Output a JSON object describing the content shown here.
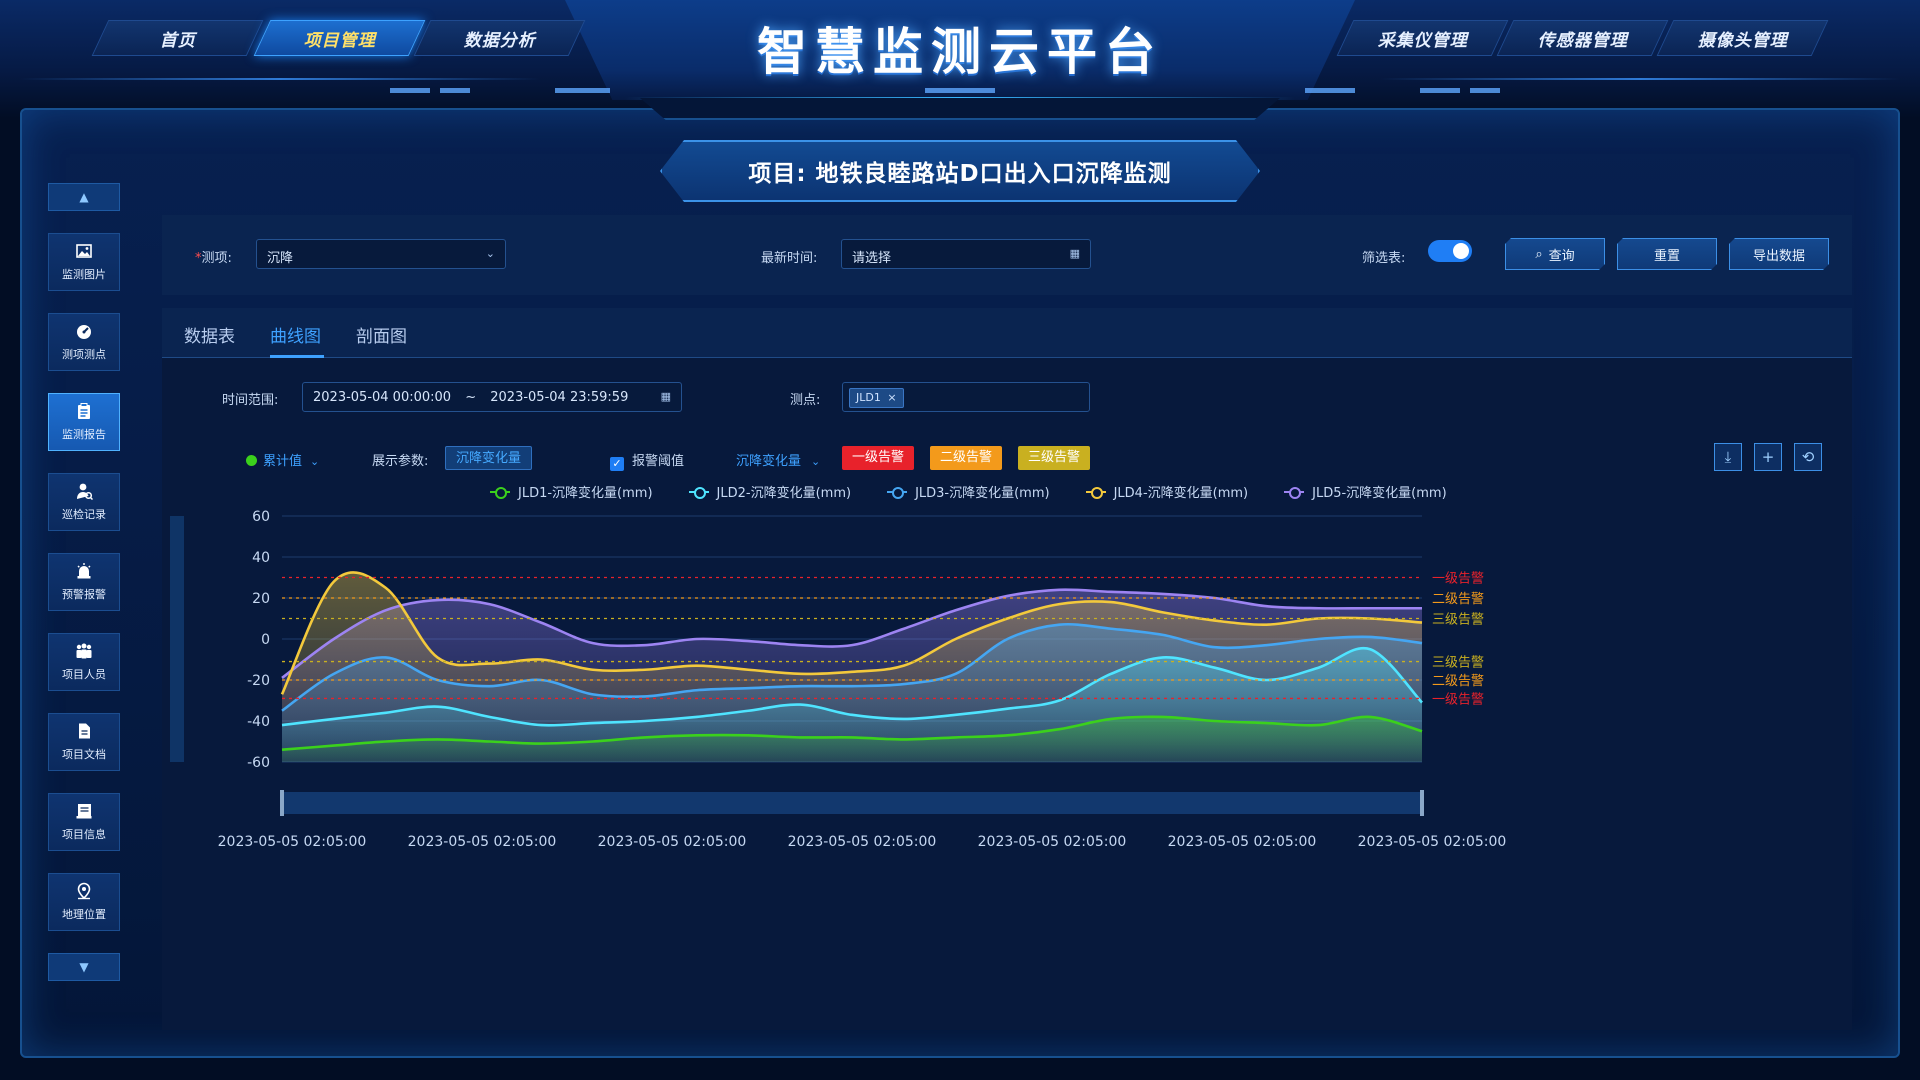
{
  "header": {
    "title": "智慧监测云平台",
    "nav_left": [
      "首页",
      "项目管理",
      "数据分析"
    ],
    "nav_right": [
      "采集仪管理",
      "传感器管理",
      "摄像头管理"
    ],
    "active_nav": "项目管理"
  },
  "project_title": "项目: 地铁良睦路站D口出入口沉降监测",
  "sidebar": {
    "items": [
      {
        "label": "监测图片",
        "icon": "image-icon"
      },
      {
        "label": "测项测点",
        "icon": "gauge-icon"
      },
      {
        "label": "监测报告",
        "icon": "clipboard-icon"
      },
      {
        "label": "巡检记录",
        "icon": "inspector-icon"
      },
      {
        "label": "预警报警",
        "icon": "alarm-icon"
      },
      {
        "label": "项目人员",
        "icon": "team-icon"
      },
      {
        "label": "项目文档",
        "icon": "document-icon"
      },
      {
        "label": "项目信息",
        "icon": "info-card-icon"
      },
      {
        "label": "地理位置",
        "icon": "location-icon"
      }
    ],
    "active": "监测报告"
  },
  "filters": {
    "item_label": "测项:",
    "item_value": "沉降",
    "time_label": "最新时间:",
    "time_placeholder": "请选择",
    "filter_table_label": "筛选表:",
    "query_button": "查询",
    "reset_button": "重置",
    "export_button": "导出数据"
  },
  "tabs": [
    "数据表",
    "曲线图",
    "剖面图"
  ],
  "active_tab": "曲线图",
  "range": {
    "label": "时间范围:",
    "start": "2023-05-04 00:00:00",
    "sep": "~",
    "end": "2023-05-04 23:59:59",
    "point_label": "测点:",
    "point_tag": "JLD1"
  },
  "controls": {
    "mode": "累计值",
    "param_label": "展示参数:",
    "param_value": "沉降变化量",
    "threshold_label": "报警阈值",
    "threshold_param": "沉降变化量",
    "alarm_pills": [
      "一级告警",
      "二级告警",
      "三级告警"
    ]
  },
  "colors": {
    "level1": "#e8222b",
    "level2": "#f39a1b",
    "level3": "#c9b020",
    "accent": "#3ea1ff"
  },
  "chart_data": {
    "type": "area",
    "y_ticks": [
      60,
      40,
      20,
      0,
      -20,
      -40,
      -60
    ],
    "ylim": [
      -60,
      60
    ],
    "x_labels": [
      "2023-05-05 02:05:00",
      "2023-05-05 02:05:00",
      "2023-05-05 02:05:00",
      "2023-05-05 02:05:00",
      "2023-05-05 02:05:00",
      "2023-05-05 02:05:00",
      "2023-05-05 02:05:00"
    ],
    "thresholds": [
      {
        "label": "一级告警",
        "value": 30,
        "color": "#e8222b"
      },
      {
        "label": "二级告警",
        "value": 20,
        "color": "#f39a1b"
      },
      {
        "label": "三级告警",
        "value": 10,
        "color": "#c9b020"
      },
      {
        "label": "三级告警",
        "value": -11,
        "color": "#c9b020"
      },
      {
        "label": "二级告警",
        "value": -20,
        "color": "#f39a1b"
      },
      {
        "label": "一级告警",
        "value": -29,
        "color": "#e8222b"
      }
    ],
    "series": [
      {
        "name": "JLD1-沉降变化量(mm)",
        "color": "#3bd11c",
        "values": [
          -54,
          -52,
          -50,
          -49,
          -50,
          -51,
          -50,
          -48,
          -47,
          -47,
          -48,
          -48,
          -49,
          -48,
          -47,
          -44,
          -39,
          -38,
          -40,
          -41,
          -42,
          -38,
          -45
        ]
      },
      {
        "name": "JLD2-沉降变化量(mm)",
        "color": "#4fe4ff",
        "values": [
          -42,
          -39,
          -36,
          -33,
          -38,
          -42,
          -41,
          -40,
          -38,
          -35,
          -32,
          -37,
          -39,
          -37,
          -34,
          -30,
          -17,
          -9,
          -14,
          -20,
          -14,
          -5,
          -31
        ]
      },
      {
        "name": "JLD3-沉降变化量(mm)",
        "color": "#45a6f2",
        "values": [
          -35,
          -17,
          -9,
          -20,
          -23,
          -20,
          -27,
          -28,
          -25,
          -24,
          -23,
          -23,
          -22,
          -17,
          0,
          7,
          5,
          2,
          -4,
          -3,
          0,
          1,
          -2
        ]
      },
      {
        "name": "JLD4-沉降变化量(mm)",
        "color": "#f3c93c",
        "values": [
          -27,
          28,
          25,
          -9,
          -12,
          -10,
          -15,
          -15,
          -13,
          -15,
          -17,
          -16,
          -13,
          0,
          10,
          17,
          18,
          13,
          9,
          7,
          10,
          10,
          8
        ]
      },
      {
        "name": "JLD5-沉降变化量(mm)",
        "color": "#9d84f2",
        "values": [
          -19,
          0,
          14,
          19,
          17,
          8,
          -2,
          -3,
          0,
          -1,
          -3,
          -3,
          5,
          14,
          21,
          24,
          23,
          22,
          20,
          16,
          15,
          15,
          15
        ]
      }
    ]
  }
}
